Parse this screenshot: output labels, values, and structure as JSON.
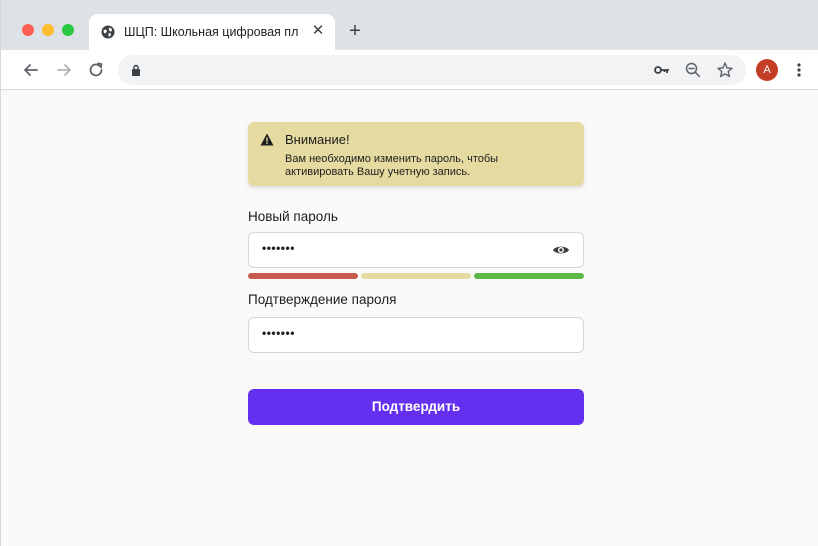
{
  "browser": {
    "tab": {
      "title": "ШЦП: Школьная цифровая пл",
      "close_glyph": "✕",
      "icon": "globe-icon"
    },
    "new_tab_glyph": "+",
    "toolbar": {
      "back_icon": "back-arrow-icon",
      "forward_icon": "forward-arrow-icon",
      "reload_icon": "reload-icon",
      "lock_icon": "lock-icon",
      "key_icon": "key-icon",
      "zoom_icon": "zoom-out-icon",
      "star_icon": "star-icon",
      "avatar_letter": "A",
      "menu_icon": "kebab-menu-icon"
    }
  },
  "alert": {
    "title": "Внимание!",
    "text": "Вам необходимо изменить пароль, чтобы активировать Вашу учетную запись.",
    "color": "#e5dba1"
  },
  "form": {
    "new_password_label": "Новый пароль",
    "new_password_value": "•••••••",
    "confirm_label": "Подтверждение пароля",
    "confirm_value": "•••••••",
    "strength": {
      "colors": [
        "#c75b50",
        "#e5dba1",
        "#5cb946"
      ]
    },
    "submit_label": "Подтвердить",
    "accent": "#652fef"
  }
}
